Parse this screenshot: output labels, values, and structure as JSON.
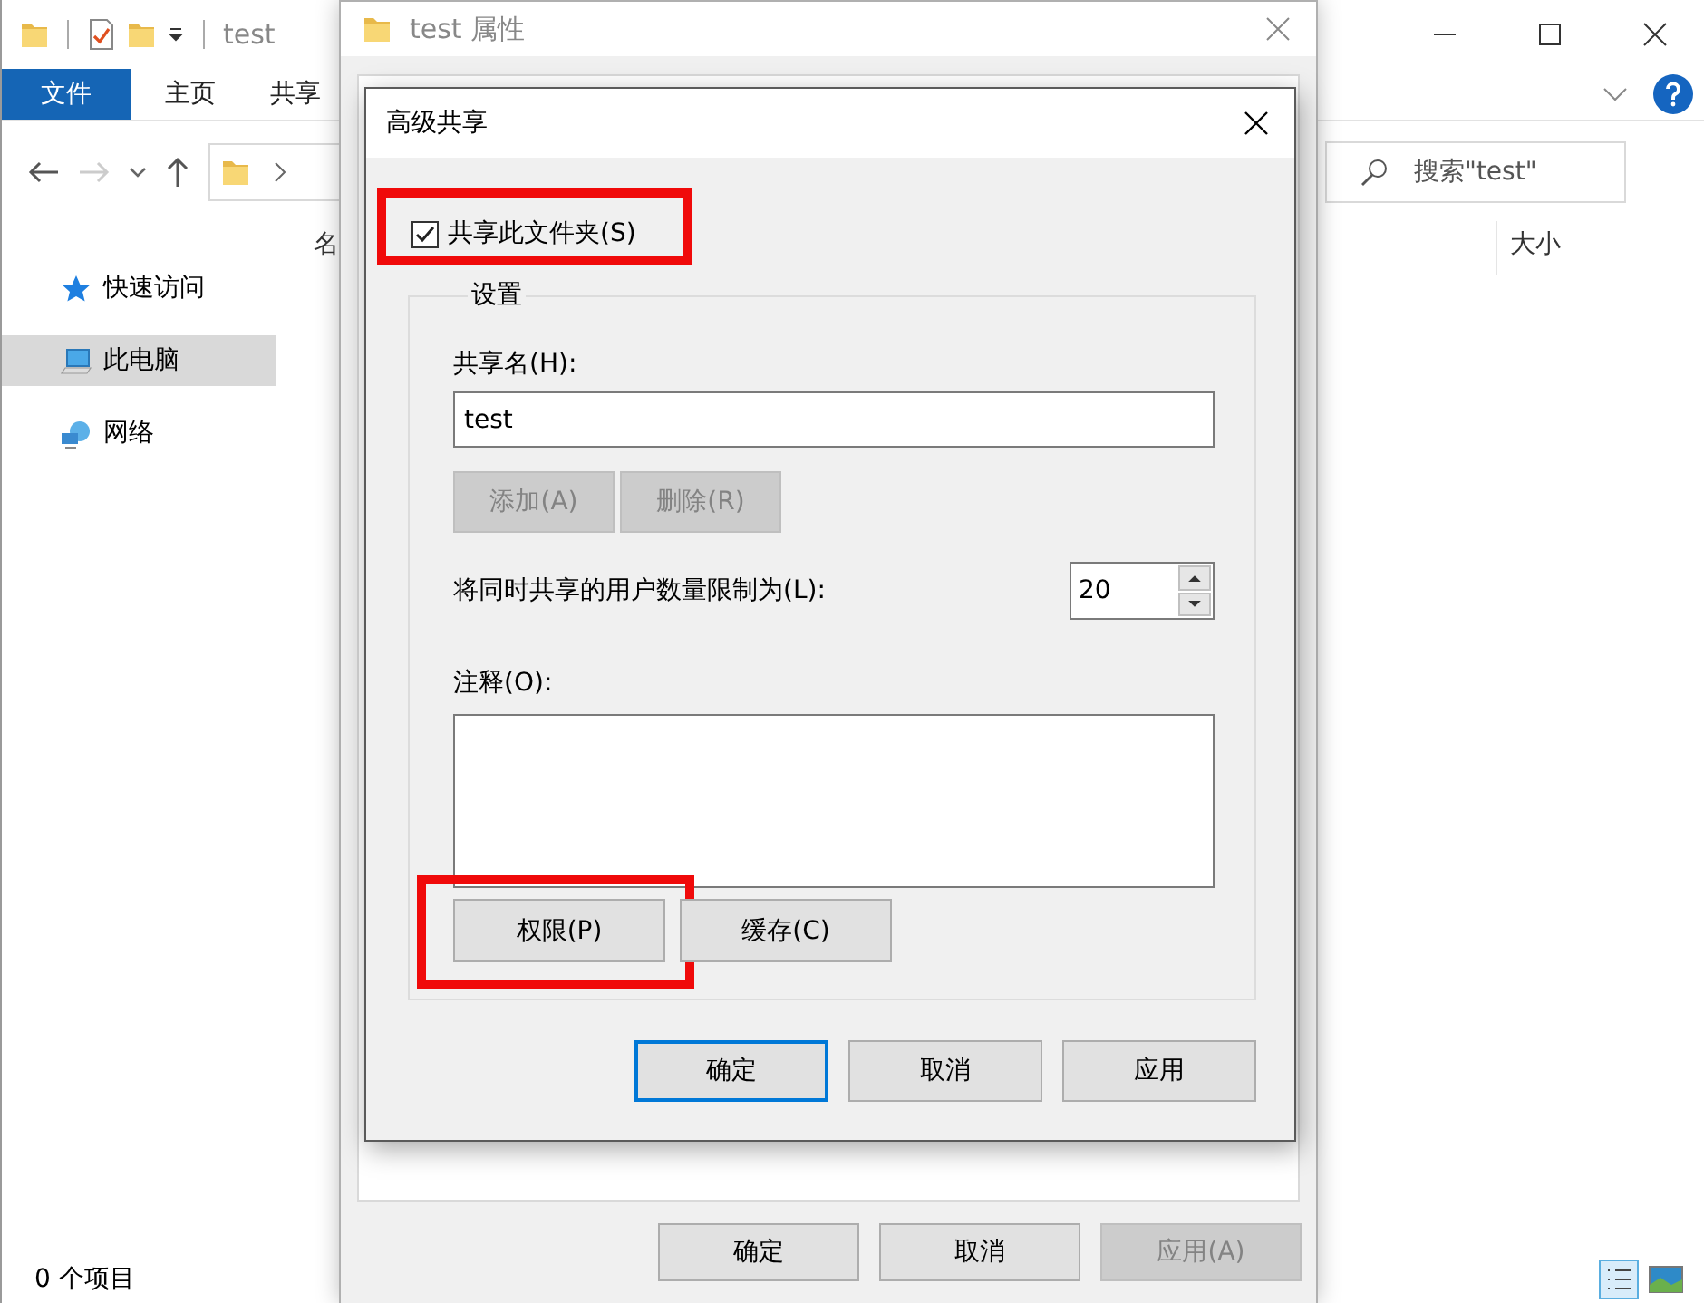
{
  "explorer": {
    "title": "test",
    "ribbon_tabs": [
      {
        "label": "文件",
        "selected": true
      },
      {
        "label": "主页",
        "selected": false
      },
      {
        "label": "共享",
        "selected": false
      }
    ],
    "search": {
      "placeholder": "搜索\"test\""
    },
    "columns": [
      "名",
      "大小"
    ],
    "sidebar": {
      "items": [
        {
          "label": "快速访问",
          "kind": "star",
          "selected": false
        },
        {
          "label": "此电脑",
          "kind": "computer",
          "selected": true
        },
        {
          "label": "网络",
          "kind": "network",
          "selected": false
        }
      ]
    },
    "status_bar": "0 个项目"
  },
  "properties": {
    "title": "test 属性",
    "buttons": [
      {
        "label": "确定",
        "disabled": false
      },
      {
        "label": "取消",
        "disabled": false
      },
      {
        "label": "应用(A)",
        "disabled": true
      }
    ]
  },
  "advanced_sharing": {
    "title": "高级共享",
    "share_checkbox": {
      "label": "共享此文件夹(S)",
      "checked": true,
      "highlighted": true
    },
    "settings": {
      "title": "设置",
      "share_name": {
        "label": "共享名(H):",
        "value": "test"
      },
      "buttons": [
        {
          "label": "添加(A)",
          "disabled": true
        },
        {
          "label": "删除(R)",
          "disabled": true
        }
      ],
      "user_limit": {
        "label": "将同时共享的用户数量限制为(L):",
        "value": "20"
      },
      "comment": {
        "label": "注释(O):"
      },
      "actions": [
        {
          "label": "权限(P)",
          "highlighted": true
        },
        {
          "label": "缓存(C)",
          "highlighted": false
        }
      ]
    },
    "buttons": [
      {
        "label": "确定",
        "default": true
      },
      {
        "label": "取消",
        "default": false
      },
      {
        "label": "应用",
        "default": false
      }
    ]
  }
}
